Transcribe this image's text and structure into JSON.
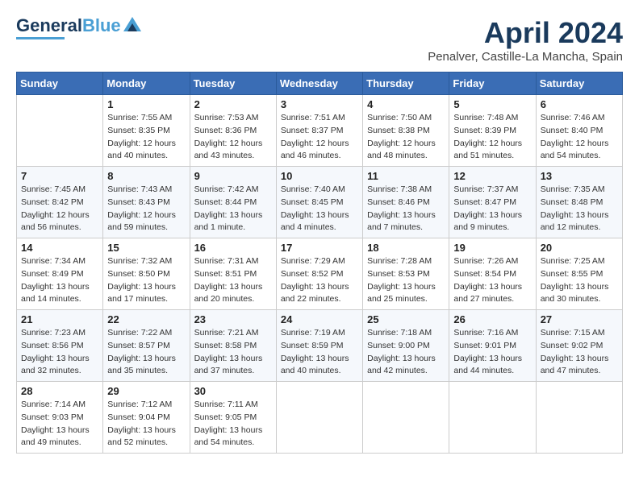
{
  "header": {
    "logo_general": "General",
    "logo_blue": "Blue",
    "title": "April 2024",
    "location": "Penalver, Castille-La Mancha, Spain"
  },
  "columns": [
    "Sunday",
    "Monday",
    "Tuesday",
    "Wednesday",
    "Thursday",
    "Friday",
    "Saturday"
  ],
  "weeks": [
    [
      {
        "day": "",
        "sunrise": "",
        "sunset": "",
        "daylight": ""
      },
      {
        "day": "1",
        "sunrise": "Sunrise: 7:55 AM",
        "sunset": "Sunset: 8:35 PM",
        "daylight": "Daylight: 12 hours and 40 minutes."
      },
      {
        "day": "2",
        "sunrise": "Sunrise: 7:53 AM",
        "sunset": "Sunset: 8:36 PM",
        "daylight": "Daylight: 12 hours and 43 minutes."
      },
      {
        "day": "3",
        "sunrise": "Sunrise: 7:51 AM",
        "sunset": "Sunset: 8:37 PM",
        "daylight": "Daylight: 12 hours and 46 minutes."
      },
      {
        "day": "4",
        "sunrise": "Sunrise: 7:50 AM",
        "sunset": "Sunset: 8:38 PM",
        "daylight": "Daylight: 12 hours and 48 minutes."
      },
      {
        "day": "5",
        "sunrise": "Sunrise: 7:48 AM",
        "sunset": "Sunset: 8:39 PM",
        "daylight": "Daylight: 12 hours and 51 minutes."
      },
      {
        "day": "6",
        "sunrise": "Sunrise: 7:46 AM",
        "sunset": "Sunset: 8:40 PM",
        "daylight": "Daylight: 12 hours and 54 minutes."
      }
    ],
    [
      {
        "day": "7",
        "sunrise": "Sunrise: 7:45 AM",
        "sunset": "Sunset: 8:42 PM",
        "daylight": "Daylight: 12 hours and 56 minutes."
      },
      {
        "day": "8",
        "sunrise": "Sunrise: 7:43 AM",
        "sunset": "Sunset: 8:43 PM",
        "daylight": "Daylight: 12 hours and 59 minutes."
      },
      {
        "day": "9",
        "sunrise": "Sunrise: 7:42 AM",
        "sunset": "Sunset: 8:44 PM",
        "daylight": "Daylight: 13 hours and 1 minute."
      },
      {
        "day": "10",
        "sunrise": "Sunrise: 7:40 AM",
        "sunset": "Sunset: 8:45 PM",
        "daylight": "Daylight: 13 hours and 4 minutes."
      },
      {
        "day": "11",
        "sunrise": "Sunrise: 7:38 AM",
        "sunset": "Sunset: 8:46 PM",
        "daylight": "Daylight: 13 hours and 7 minutes."
      },
      {
        "day": "12",
        "sunrise": "Sunrise: 7:37 AM",
        "sunset": "Sunset: 8:47 PM",
        "daylight": "Daylight: 13 hours and 9 minutes."
      },
      {
        "day": "13",
        "sunrise": "Sunrise: 7:35 AM",
        "sunset": "Sunset: 8:48 PM",
        "daylight": "Daylight: 13 hours and 12 minutes."
      }
    ],
    [
      {
        "day": "14",
        "sunrise": "Sunrise: 7:34 AM",
        "sunset": "Sunset: 8:49 PM",
        "daylight": "Daylight: 13 hours and 14 minutes."
      },
      {
        "day": "15",
        "sunrise": "Sunrise: 7:32 AM",
        "sunset": "Sunset: 8:50 PM",
        "daylight": "Daylight: 13 hours and 17 minutes."
      },
      {
        "day": "16",
        "sunrise": "Sunrise: 7:31 AM",
        "sunset": "Sunset: 8:51 PM",
        "daylight": "Daylight: 13 hours and 20 minutes."
      },
      {
        "day": "17",
        "sunrise": "Sunrise: 7:29 AM",
        "sunset": "Sunset: 8:52 PM",
        "daylight": "Daylight: 13 hours and 22 minutes."
      },
      {
        "day": "18",
        "sunrise": "Sunrise: 7:28 AM",
        "sunset": "Sunset: 8:53 PM",
        "daylight": "Daylight: 13 hours and 25 minutes."
      },
      {
        "day": "19",
        "sunrise": "Sunrise: 7:26 AM",
        "sunset": "Sunset: 8:54 PM",
        "daylight": "Daylight: 13 hours and 27 minutes."
      },
      {
        "day": "20",
        "sunrise": "Sunrise: 7:25 AM",
        "sunset": "Sunset: 8:55 PM",
        "daylight": "Daylight: 13 hours and 30 minutes."
      }
    ],
    [
      {
        "day": "21",
        "sunrise": "Sunrise: 7:23 AM",
        "sunset": "Sunset: 8:56 PM",
        "daylight": "Daylight: 13 hours and 32 minutes."
      },
      {
        "day": "22",
        "sunrise": "Sunrise: 7:22 AM",
        "sunset": "Sunset: 8:57 PM",
        "daylight": "Daylight: 13 hours and 35 minutes."
      },
      {
        "day": "23",
        "sunrise": "Sunrise: 7:21 AM",
        "sunset": "Sunset: 8:58 PM",
        "daylight": "Daylight: 13 hours and 37 minutes."
      },
      {
        "day": "24",
        "sunrise": "Sunrise: 7:19 AM",
        "sunset": "Sunset: 8:59 PM",
        "daylight": "Daylight: 13 hours and 40 minutes."
      },
      {
        "day": "25",
        "sunrise": "Sunrise: 7:18 AM",
        "sunset": "Sunset: 9:00 PM",
        "daylight": "Daylight: 13 hours and 42 minutes."
      },
      {
        "day": "26",
        "sunrise": "Sunrise: 7:16 AM",
        "sunset": "Sunset: 9:01 PM",
        "daylight": "Daylight: 13 hours and 44 minutes."
      },
      {
        "day": "27",
        "sunrise": "Sunrise: 7:15 AM",
        "sunset": "Sunset: 9:02 PM",
        "daylight": "Daylight: 13 hours and 47 minutes."
      }
    ],
    [
      {
        "day": "28",
        "sunrise": "Sunrise: 7:14 AM",
        "sunset": "Sunset: 9:03 PM",
        "daylight": "Daylight: 13 hours and 49 minutes."
      },
      {
        "day": "29",
        "sunrise": "Sunrise: 7:12 AM",
        "sunset": "Sunset: 9:04 PM",
        "daylight": "Daylight: 13 hours and 52 minutes."
      },
      {
        "day": "30",
        "sunrise": "Sunrise: 7:11 AM",
        "sunset": "Sunset: 9:05 PM",
        "daylight": "Daylight: 13 hours and 54 minutes."
      },
      {
        "day": "",
        "sunrise": "",
        "sunset": "",
        "daylight": ""
      },
      {
        "day": "",
        "sunrise": "",
        "sunset": "",
        "daylight": ""
      },
      {
        "day": "",
        "sunrise": "",
        "sunset": "",
        "daylight": ""
      },
      {
        "day": "",
        "sunrise": "",
        "sunset": "",
        "daylight": ""
      }
    ]
  ]
}
